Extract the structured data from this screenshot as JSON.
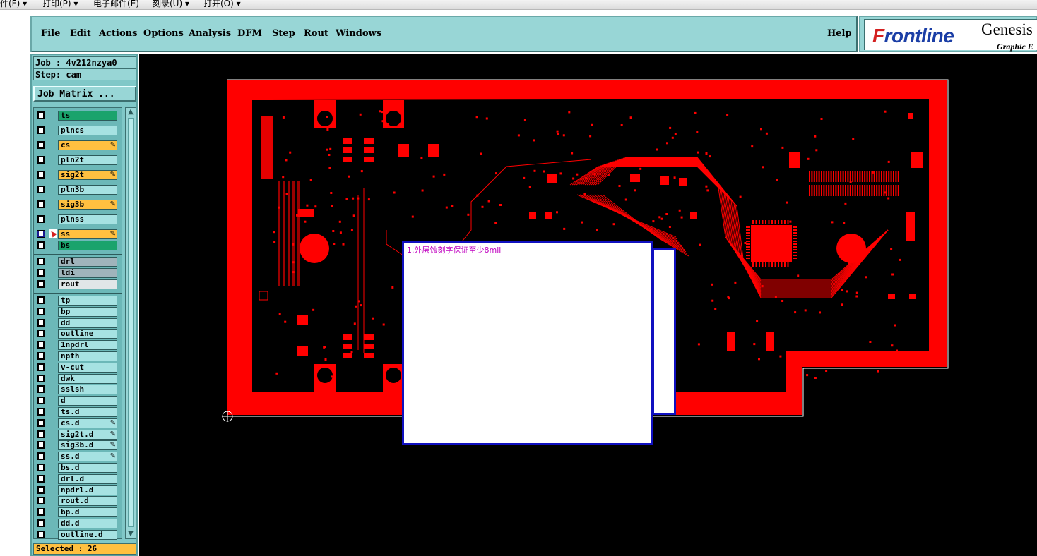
{
  "topbar": {
    "items": [
      "件(F) ▾",
      "打印(P) ▾",
      "电子邮件(E)",
      "刻录(U) ▾",
      "打开(O) ▾"
    ]
  },
  "menu": {
    "items": [
      "File",
      "Edit",
      "Actions",
      "Options",
      "Analysis",
      "DFM",
      "Step",
      "Rout",
      "Windows"
    ],
    "help": "Help"
  },
  "logo": {
    "brand_f": "F",
    "brand_rest": "rontline",
    "product": "Genesis",
    "subtitle": "Graphic E"
  },
  "job": {
    "job_line": "Job : 4v212nzya0",
    "step_line": "Step: cam",
    "matrix_button": "Job Matrix ..."
  },
  "layers": [
    {
      "name": "ts",
      "style": "green"
    },
    {
      "name": "plncs",
      "style": "normal"
    },
    {
      "name": "cs",
      "style": "board",
      "pin": "✎"
    },
    {
      "name": "pln2t",
      "style": "normal"
    },
    {
      "name": "sig2t",
      "style": "board",
      "pin": "✎"
    },
    {
      "name": "pln3b",
      "style": "normal"
    },
    {
      "name": "sig3b",
      "style": "board",
      "pin": "✎"
    },
    {
      "name": "plnss",
      "style": "normal"
    },
    {
      "name": "ss",
      "style": "board",
      "pin": "✎",
      "active": true
    },
    {
      "name": "bs",
      "style": "green"
    },
    {
      "name": "drl",
      "style": "grey"
    },
    {
      "name": "ldi",
      "style": "grey"
    },
    {
      "name": "rout",
      "style": "white"
    },
    {
      "name": "tp",
      "style": "normal"
    },
    {
      "name": "bp",
      "style": "normal"
    },
    {
      "name": "dd",
      "style": "normal"
    },
    {
      "name": "outline",
      "style": "normal"
    },
    {
      "name": "1npdrl",
      "style": "normal"
    },
    {
      "name": "npth",
      "style": "normal"
    },
    {
      "name": "v-cut",
      "style": "normal"
    },
    {
      "name": "dwk",
      "style": "normal"
    },
    {
      "name": "sslsh",
      "style": "normal"
    },
    {
      "name": "d",
      "style": "normal"
    },
    {
      "name": "ts.d",
      "style": "normal"
    },
    {
      "name": "cs.d",
      "style": "normal",
      "pin": "✎"
    },
    {
      "name": "sig2t.d",
      "style": "normal",
      "pin": "✎"
    },
    {
      "name": "sig3b.d",
      "style": "normal",
      "pin": "✎"
    },
    {
      "name": "ss.d",
      "style": "normal",
      "pin": "✎"
    },
    {
      "name": "bs.d",
      "style": "normal"
    },
    {
      "name": "drl.d",
      "style": "normal"
    },
    {
      "name": "npdrl.d",
      "style": "normal"
    },
    {
      "name": "rout.d",
      "style": "normal"
    },
    {
      "name": "bp.d",
      "style": "normal"
    },
    {
      "name": "dd.d",
      "style": "normal"
    },
    {
      "name": "outline.d",
      "style": "normal"
    }
  ],
  "status": {
    "selected": "Selected : 26"
  },
  "note": {
    "text": "1.外层蚀刻字保证至少8mil"
  },
  "colors": {
    "copper": "#ff0000",
    "canvas": "#000000",
    "panel": "#98d6d6",
    "board_layer": "#ffc040",
    "note_border": "#1010c0",
    "note_text": "#c000c0"
  }
}
